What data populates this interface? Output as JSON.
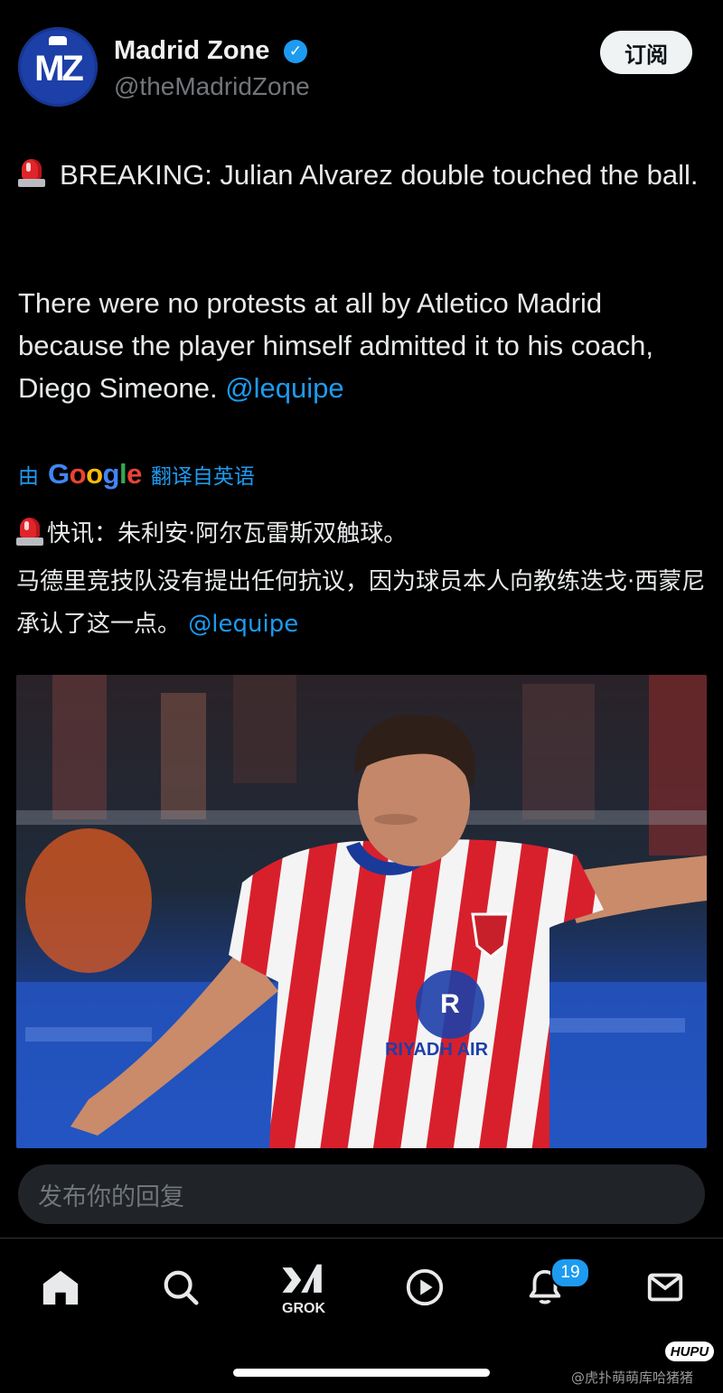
{
  "header": {
    "avatar_text": "MZ",
    "display_name": "Madrid Zone",
    "handle": "@theMadridZone",
    "subscribe_label": "订阅"
  },
  "tweet": {
    "paragraph1": "BREAKING: Julian Alvarez double touched the ball.",
    "paragraph2": "There were no protests at all by Atletico Madrid because the player himself admitted it to his coach, Diego Simeone.",
    "mention": "@lequipe"
  },
  "translation": {
    "prefix": "由",
    "provider": "Google",
    "suffix": "翻译自英语",
    "line1": "快讯：朱利安·阿尔瓦雷斯双触球。",
    "line2": "马德里竞技队没有提出任何抗议，因为球员本人向教练迭戈·西蒙尼承认了这一点。",
    "mention": "@lequipe"
  },
  "media": {
    "jersey_text": "RIYADH AIR"
  },
  "reply": {
    "placeholder": "发布你的回复"
  },
  "nav": {
    "grok_label": "GROK",
    "notification_count": "19"
  },
  "watermark": {
    "logo": "HUPU",
    "text": "@虎扑萌萌库哈猪猪"
  },
  "colors": {
    "accent": "#1d9bf0",
    "background": "#000000",
    "text": "#e7e9ea",
    "secondary_text": "#71767b"
  }
}
